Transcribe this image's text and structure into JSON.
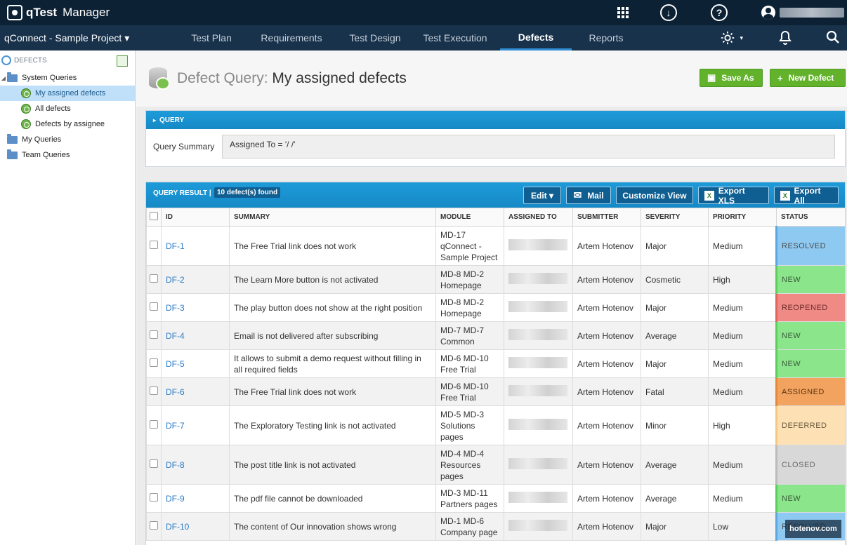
{
  "app": {
    "brand": "qTest",
    "name": "Manager"
  },
  "topbar": {
    "grid_icon": "apps-grid-icon",
    "download_icon": "download-icon",
    "help_icon": "help-icon",
    "help_text": "?",
    "download_text": "↓"
  },
  "project": {
    "name": "qConnect - Sample Project ▾"
  },
  "nav": {
    "tabs": [
      {
        "label": "Test Plan"
      },
      {
        "label": "Requirements"
      },
      {
        "label": "Test Design"
      },
      {
        "label": "Test Execution"
      },
      {
        "label": "Defects"
      },
      {
        "label": "Reports"
      }
    ],
    "active": "Defects"
  },
  "sidebar": {
    "title": "DEFECTS",
    "items": [
      {
        "label": "System Queries"
      },
      {
        "label": "My assigned defects"
      },
      {
        "label": "All defects"
      },
      {
        "label": "Defects by assignee"
      },
      {
        "label": "My Queries"
      },
      {
        "label": "Team Queries"
      }
    ]
  },
  "header": {
    "title_label": "Defect Query:",
    "title_value": "My assigned defects",
    "save_as": "Save As",
    "new_defect": "New Defect"
  },
  "query": {
    "panel_title": "QUERY",
    "summary_label": "Query Summary",
    "summary_value": "Assigned To = '/                  /'"
  },
  "results": {
    "title": "QUERY RESULT |",
    "count": "10 defect(s) found",
    "buttons": {
      "edit": "Edit ▾",
      "mail": "Mail",
      "customize": "Customize View",
      "export_xls": "Export XLS",
      "export_all": "Export All"
    },
    "columns": [
      "ID",
      "SUMMARY",
      "MODULE",
      "ASSIGNED TO",
      "SUBMITTER",
      "SEVERITY",
      "PRIORITY",
      "STATUS"
    ],
    "rows": [
      {
        "id": "DF-1",
        "summary": "The Free Trial link does not work",
        "module": "MD-17 qConnect - Sample Project",
        "submitter": "Artem Hotenov",
        "severity": "Major",
        "priority": "Medium",
        "status": "RESOLVED"
      },
      {
        "id": "DF-2",
        "summary": "The Learn More button is not activated",
        "module": "MD-8 MD-2 Homepage",
        "submitter": "Artem Hotenov",
        "severity": "Cosmetic",
        "priority": "High",
        "status": "NEW"
      },
      {
        "id": "DF-3",
        "summary": "The play button does not show at the right position",
        "module": "MD-8 MD-2 Homepage",
        "submitter": "Artem Hotenov",
        "severity": "Major",
        "priority": "Medium",
        "status": "REOPENED"
      },
      {
        "id": "DF-4",
        "summary": "Email is not delivered after subscribing",
        "module": "MD-7 MD-7 Common",
        "submitter": "Artem Hotenov",
        "severity": "Average",
        "priority": "Medium",
        "status": "NEW"
      },
      {
        "id": "DF-5",
        "summary": "It allows to submit a demo request without filling in all required fields",
        "module": "MD-6 MD-10 Free Trial",
        "submitter": "Artem Hotenov",
        "severity": "Major",
        "priority": "Medium",
        "status": "NEW"
      },
      {
        "id": "DF-6",
        "summary": "The Free Trial link does not work",
        "module": "MD-6 MD-10 Free Trial",
        "submitter": "Artem Hotenov",
        "severity": "Fatal",
        "priority": "Medium",
        "status": "ASSIGNED"
      },
      {
        "id": "DF-7",
        "summary": "The Exploratory Testing link is not activated",
        "module": "MD-5 MD-3 Solutions pages",
        "submitter": "Artem Hotenov",
        "severity": "Minor",
        "priority": "High",
        "status": "DEFERRED"
      },
      {
        "id": "DF-8",
        "summary": "The post title link is not activated",
        "module": "MD-4 MD-4 Resources pages",
        "submitter": "Artem Hotenov",
        "severity": "Average",
        "priority": "Medium",
        "status": "CLOSED"
      },
      {
        "id": "DF-9",
        "summary": "The pdf file cannot be downloaded",
        "module": "MD-3 MD-11 Partners pages",
        "submitter": "Artem Hotenov",
        "severity": "Average",
        "priority": "Medium",
        "status": "NEW"
      },
      {
        "id": "DF-10",
        "summary": "The content of Our innovation shows wrong",
        "module": "MD-1 MD-6 Company page",
        "submitter": "Artem Hotenov",
        "severity": "Major",
        "priority": "Low",
        "status": "RESOLVED"
      }
    ]
  },
  "watermark": "hotenov.com",
  "colors": {
    "topbar": "#0d2134",
    "navbar": "#18324b",
    "accent": "#1e9bd9",
    "green": "#62b32b"
  }
}
